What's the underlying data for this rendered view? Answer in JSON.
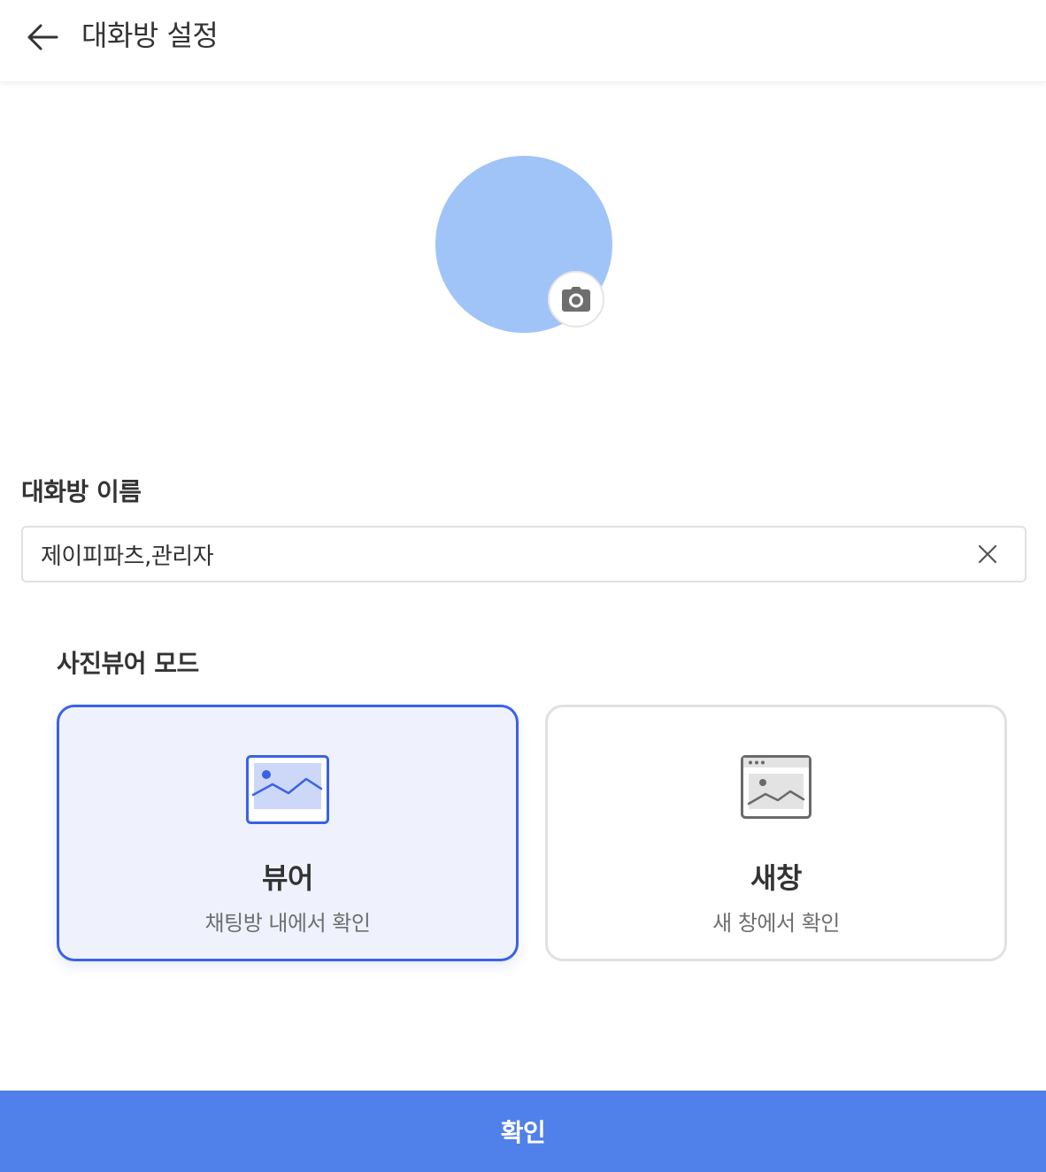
{
  "header": {
    "back_icon": "arrow-left-icon",
    "title": "대화방 설정"
  },
  "avatar": {
    "color": "#a0c4f8",
    "camera_icon": "camera-icon"
  },
  "room_name": {
    "label": "대화방 이름",
    "value": "제이피파츠,관리자",
    "clear_icon": "close-icon"
  },
  "viewer_mode": {
    "label": "사진뷰어 모드",
    "options": [
      {
        "title": "뷰어",
        "subtitle": "채팅방 내에서 확인",
        "icon": "image-icon",
        "selected": true
      },
      {
        "title": "새창",
        "subtitle": "새 창에서 확인",
        "icon": "browser-image-icon",
        "selected": false
      }
    ]
  },
  "confirm": {
    "label": "확인",
    "color": "#5080ea"
  },
  "colors": {
    "accent": "#3a62e6",
    "selected_bg": "#eff2fd"
  }
}
